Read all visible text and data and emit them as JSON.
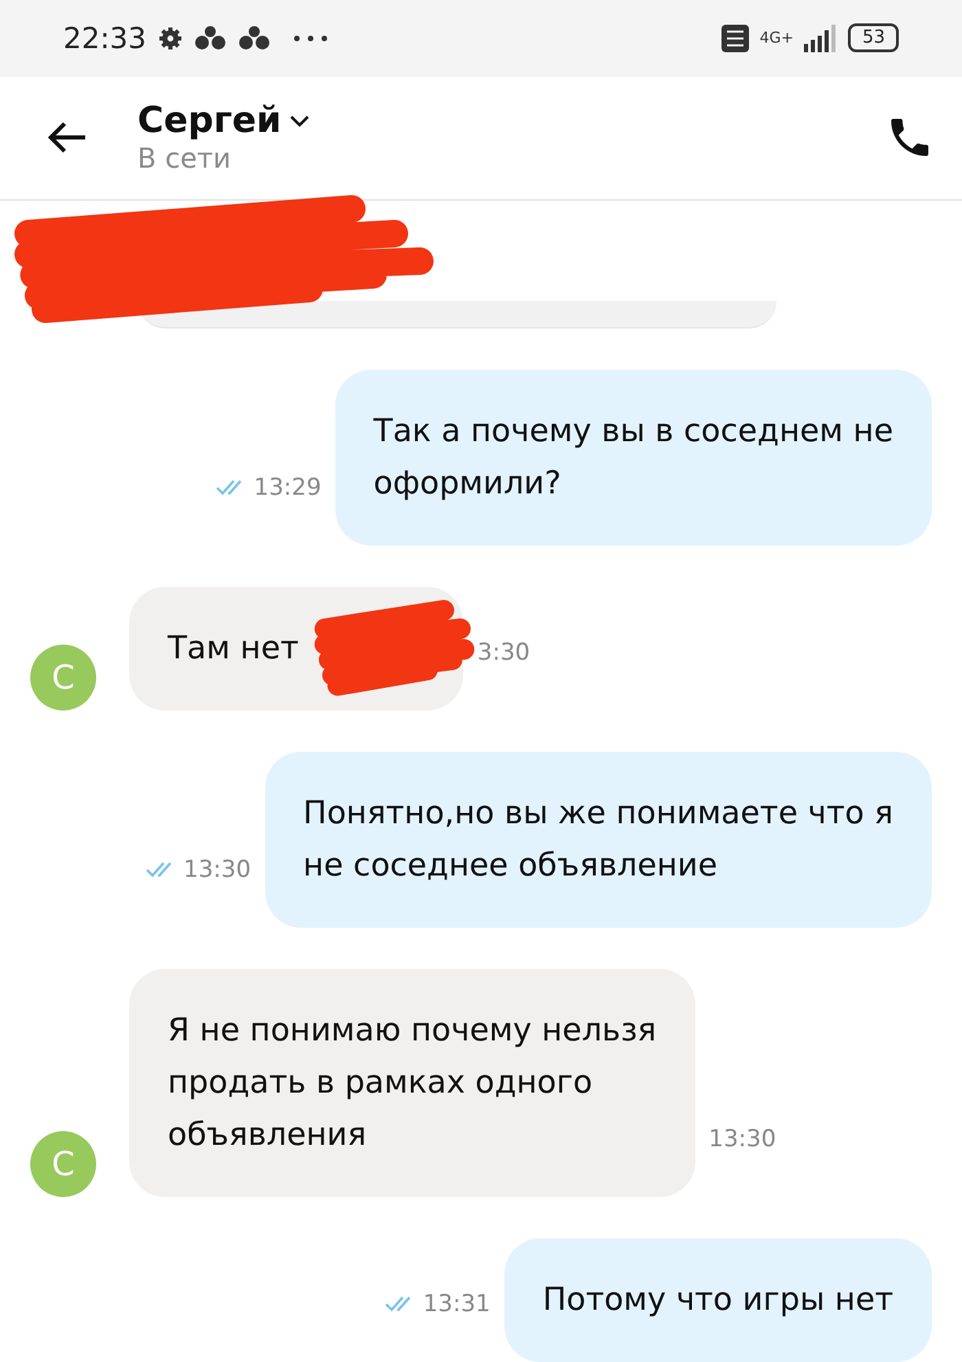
{
  "status_bar": {
    "time": "22:33",
    "network": "4G+",
    "battery": "53"
  },
  "header": {
    "name": "Сергей",
    "status": "В сети"
  },
  "messages": [
    {
      "kind": "outgoing",
      "lines": [
        "Так а почему вы в соседнем не",
        "оформили?"
      ],
      "time": "13:29",
      "read": true
    },
    {
      "kind": "incoming",
      "avatar": "С",
      "lines": [
        "Там нет"
      ],
      "time": "3:30",
      "redacted": true
    },
    {
      "kind": "outgoing",
      "lines": [
        "Понятно,но вы же понимаете что я",
        "не соседнее объявление"
      ],
      "time": "13:30",
      "read": true
    },
    {
      "kind": "incoming",
      "avatar": "С",
      "lines": [
        "Я не понимаю почему нельзя",
        "продать в рамках одного",
        "объявления"
      ],
      "time": "13:30",
      "redacted": false
    },
    {
      "kind": "outgoing",
      "lines": [
        "Потому что игры нет"
      ],
      "time": "13:31",
      "read": true
    }
  ]
}
